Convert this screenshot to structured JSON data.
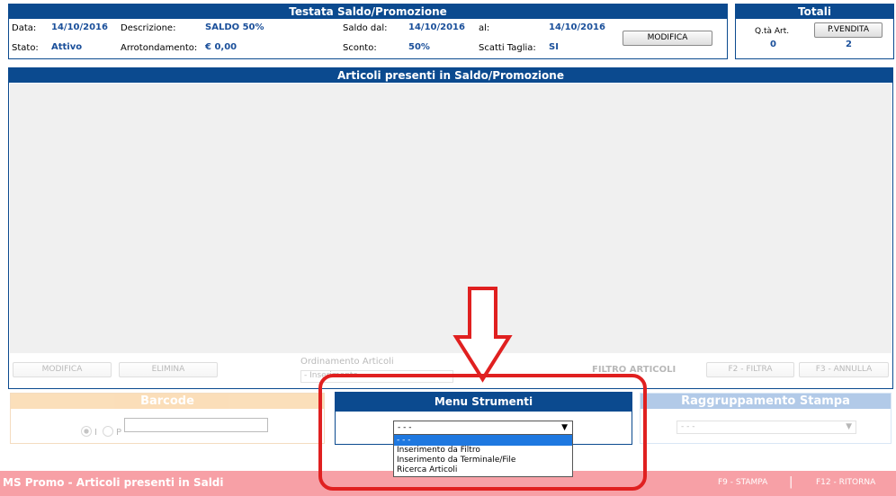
{
  "header": {
    "title": "Testata Saldo/Promozione",
    "data_label": "Data:",
    "data_value": "14/10/2016",
    "descrizione_label": "Descrizione:",
    "descrizione_value": "SALDO 50%",
    "saldo_dal_label": "Saldo dal:",
    "saldo_dal_value": "14/10/2016",
    "al_label": "al:",
    "al_value": "14/10/2016",
    "stato_label": "Stato:",
    "stato_value": "Attivo",
    "arrotondamento_label": "Arrotondamento:",
    "arrotondamento_value": "€ 0,00",
    "sconto_label": "Sconto:",
    "sconto_value": "50%",
    "scatti_label": "Scatti Taglia:",
    "scatti_value": "SI",
    "modifica_button": "MODIFICA"
  },
  "totali": {
    "title": "Totali",
    "qta_label": "Q.tà Art.",
    "qta_value": "0",
    "pvendita_button": "P.VENDITA",
    "pvendita_value": "2"
  },
  "articoli": {
    "title": "Articoli presenti in Saldo/Promozione",
    "modifica_button": "MODIFICA",
    "elimina_button": "ELIMINA",
    "ordinamento_label": "Ordinamento Articoli",
    "ordinamento_value": "- Inserimento -",
    "filtro_label": "FILTRO ARTICOLI",
    "filtra_button": "F2 - FILTRA",
    "annulla_button": "F3 - ANNULLA"
  },
  "barcode": {
    "title": "Barcode",
    "radio_i": "I",
    "radio_p": "P"
  },
  "menu_strumenti": {
    "title": "Menu Strumenti",
    "selected": "- - -",
    "options": [
      "- - -",
      "Inserimento da Filtro",
      "Inserimento da Terminale/File",
      "Ricerca Articoli"
    ]
  },
  "raggruppamento": {
    "title": "Raggruppamento Stampa",
    "selected": "- - -"
  },
  "footer": {
    "title": "MS Promo - Articoli presenti in Saldi",
    "stampa": "F9 - STAMPA",
    "separator": "|",
    "ritorna": "F12 - RITORNA"
  },
  "colors": {
    "header_blue": "#0b4a8f",
    "value_blue": "#1a4f9a",
    "annotation_red": "#e02020",
    "footer_pink": "#f7a0a6",
    "barcode_header": "#f9c98c",
    "raggruppamento_header": "#9fbde3"
  }
}
